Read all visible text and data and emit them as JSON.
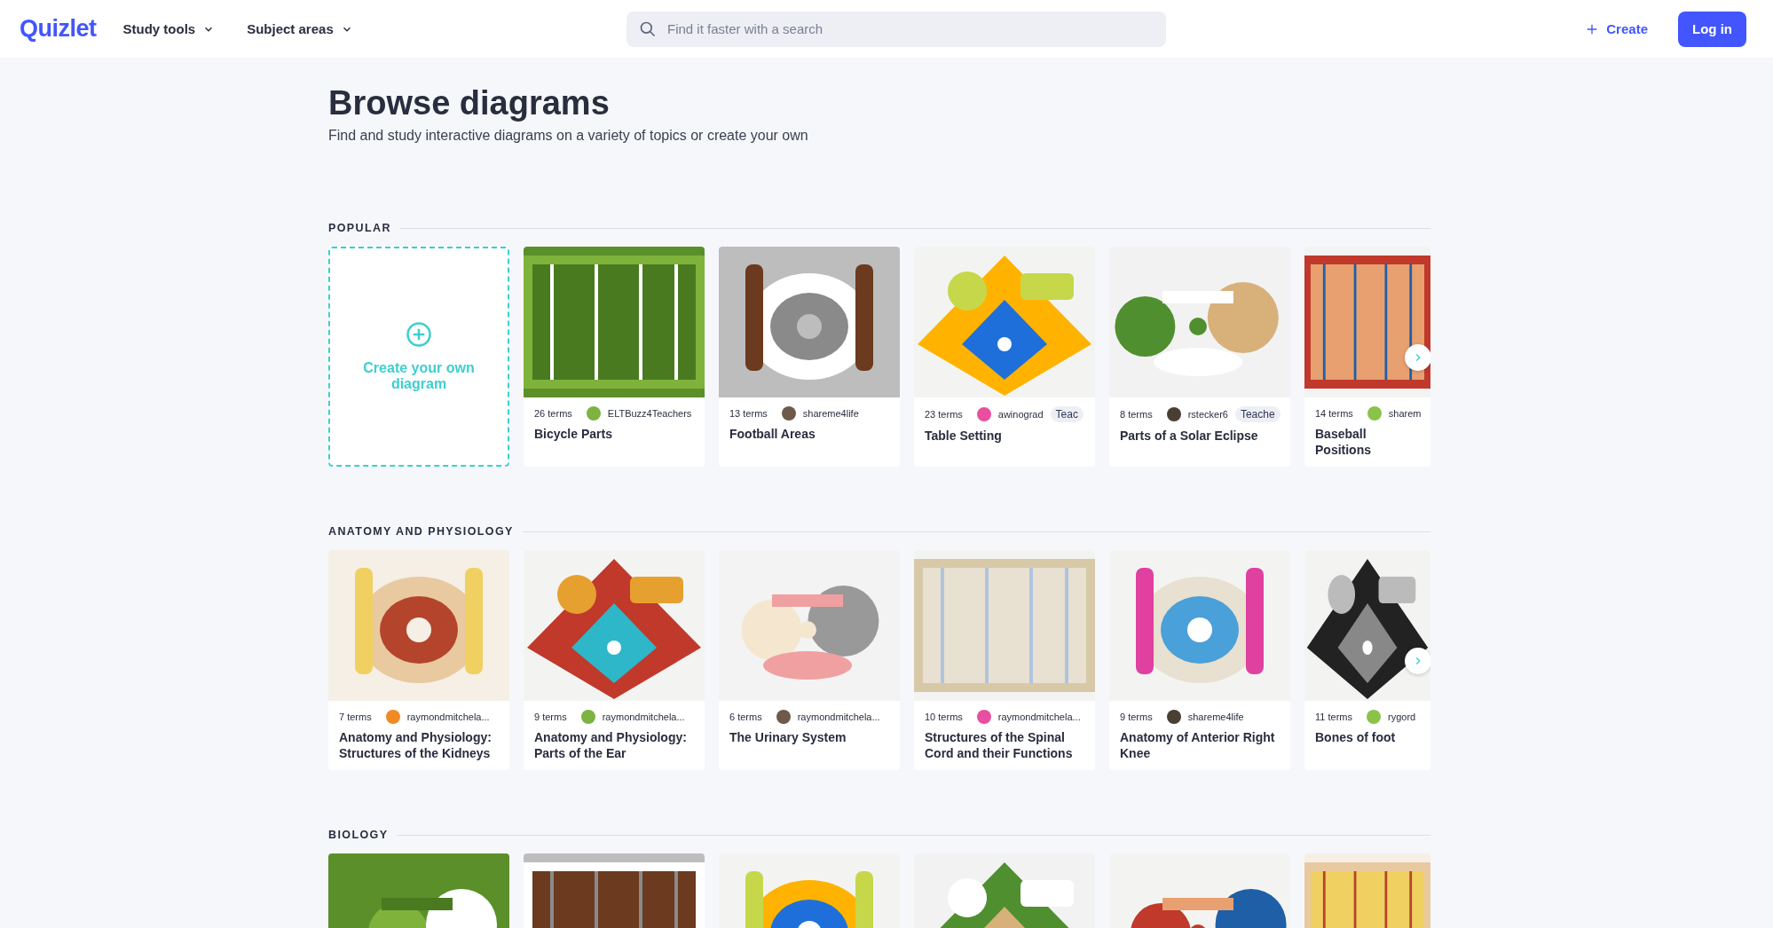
{
  "header": {
    "logo": "Quizlet",
    "menus": [
      {
        "label": "Study tools"
      },
      {
        "label": "Subject areas"
      }
    ],
    "search": {
      "placeholder": "Find it faster with a search"
    },
    "create": "Create",
    "login": "Log in"
  },
  "page": {
    "title": "Browse diagrams",
    "subtitle": "Find and study interactive diagrams on a variety of topics or create your own"
  },
  "sections": [
    {
      "title": "POPULAR",
      "cards": [
        {
          "kind": "create",
          "label": "Create your own diagram"
        },
        {
          "kind": "diagram",
          "terms": "26 terms",
          "author": "ELTBuzz4Teachers",
          "title": "Bicycle Parts"
        },
        {
          "kind": "diagram",
          "terms": "13 terms",
          "author": "shareme4life",
          "title": "Football Areas"
        },
        {
          "kind": "diagram",
          "terms": "23 terms",
          "author": "awinograd",
          "badge": "Teac",
          "title": "Table Setting"
        },
        {
          "kind": "diagram",
          "terms": "8 terms",
          "author": "rstecker6",
          "badge": "Teache",
          "title": "Parts of a Solar Eclipse"
        },
        {
          "kind": "diagram",
          "terms": "14 terms",
          "author": "sharem",
          "title": "Baseball Positions"
        }
      ]
    },
    {
      "title": "ANATOMY AND PHYSIOLOGY",
      "cards": [
        {
          "kind": "diagram",
          "terms": "7 terms",
          "author": "raymondmitchela...",
          "title": "Anatomy and Physiology: Structures of the Kidneys"
        },
        {
          "kind": "diagram",
          "terms": "9 terms",
          "author": "raymondmitchela...",
          "title": "Anatomy and Physiology: Parts of the Ear"
        },
        {
          "kind": "diagram",
          "terms": "6 terms",
          "author": "raymondmitchela...",
          "title": "The Urinary System"
        },
        {
          "kind": "diagram",
          "terms": "10 terms",
          "author": "raymondmitchela...",
          "title": "Structures of the Spinal Cord and their Functions"
        },
        {
          "kind": "diagram",
          "terms": "9 terms",
          "author": "shareme4life",
          "title": "Anatomy of Anterior Right Knee"
        },
        {
          "kind": "diagram",
          "terms": "11 terms",
          "author": "rygord",
          "title": "Bones of foot"
        }
      ]
    },
    {
      "title": "BIOLOGY"
    }
  ]
}
